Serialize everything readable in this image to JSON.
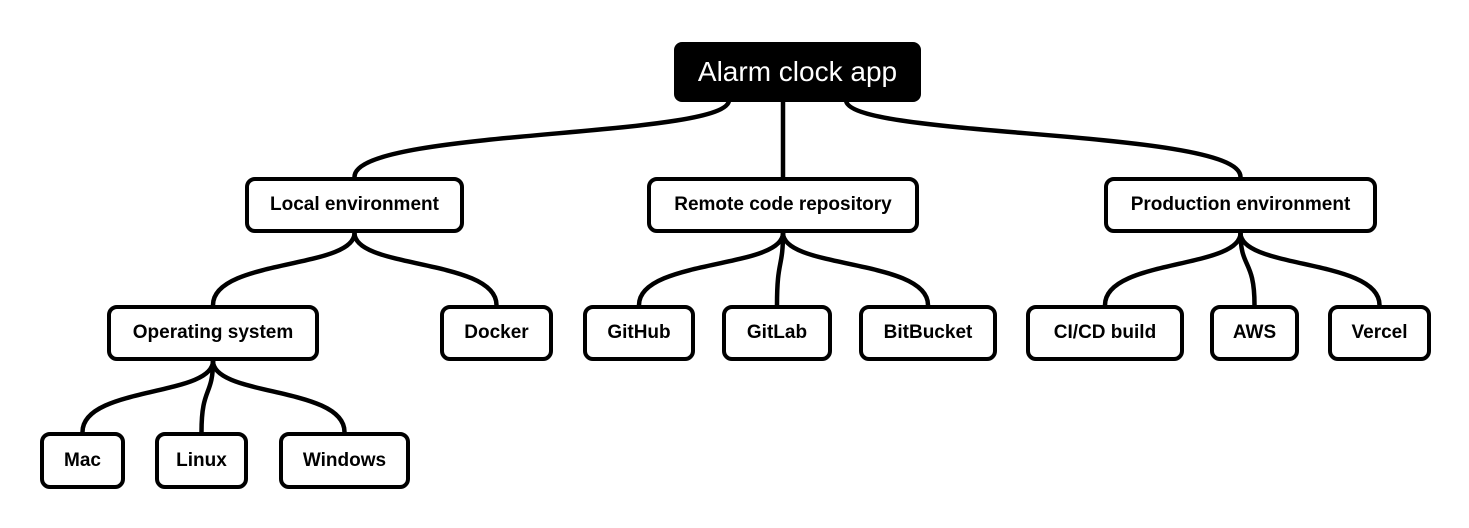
{
  "diagram": {
    "type": "mind-map",
    "root": {
      "id": "root",
      "label": "Alarm clock app"
    },
    "nodes": [
      {
        "id": "local",
        "label": "Local environment",
        "parent": "root"
      },
      {
        "id": "remote",
        "label": "Remote code repository",
        "parent": "root"
      },
      {
        "id": "prod",
        "label": "Production environment",
        "parent": "root"
      },
      {
        "id": "os",
        "label": "Operating system",
        "parent": "local"
      },
      {
        "id": "docker",
        "label": "Docker",
        "parent": "local"
      },
      {
        "id": "github",
        "label": "GitHub",
        "parent": "remote"
      },
      {
        "id": "gitlab",
        "label": "GitLab",
        "parent": "remote"
      },
      {
        "id": "bitbucket",
        "label": "BitBucket",
        "parent": "remote"
      },
      {
        "id": "cicd",
        "label": "CI/CD build",
        "parent": "prod"
      },
      {
        "id": "aws",
        "label": "AWS",
        "parent": "prod"
      },
      {
        "id": "vercel",
        "label": "Vercel",
        "parent": "prod"
      },
      {
        "id": "mac",
        "label": "Mac",
        "parent": "os"
      },
      {
        "id": "linux",
        "label": "Linux",
        "parent": "os"
      },
      {
        "id": "windows",
        "label": "Windows",
        "parent": "os"
      }
    ]
  }
}
